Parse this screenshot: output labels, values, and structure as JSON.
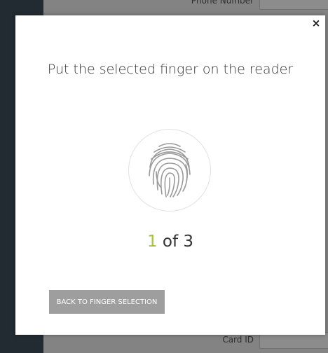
{
  "background": {
    "fields": [
      {
        "label": "Phone Number",
        "value": ""
      },
      {
        "label": "Card ID",
        "value": ""
      }
    ]
  },
  "dialog": {
    "close_label": "×",
    "title": "Put the selected finger on the reader",
    "progress": {
      "current": "1",
      "separator": "of",
      "total": "3"
    },
    "back_button_label": "BACK TO FINGER SELECTION",
    "icon": "fingerprint-icon",
    "accent_color": "#a7c23a"
  }
}
